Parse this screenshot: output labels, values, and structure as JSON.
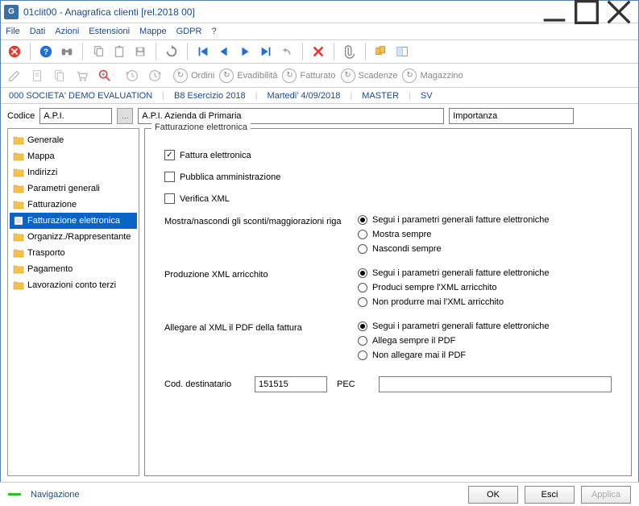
{
  "window": {
    "title": "01clit00 - Anagrafica clienti  [rel.2018 00]"
  },
  "menu": {
    "file": "File",
    "dati": "Dati",
    "azioni": "Azioni",
    "estensioni": "Estensioni",
    "mappe": "Mappe",
    "gdpr": "GDPR",
    "help": "?"
  },
  "toolbar2": {
    "ordini": "Ordini",
    "evadibilita": "Evadibilità",
    "fatturato": "Fatturato",
    "scadenze": "Scadenze",
    "magazzino": "Magazzino"
  },
  "status": {
    "company": "000 SOCIETA' DEMO EVALUATION",
    "exercise": "B8 Esercizio 2018",
    "date": "Martedi'  4/09/2018",
    "user": "MASTER",
    "sv": "SV"
  },
  "codice": {
    "label": "Codice",
    "value": "A.P.I.",
    "desc": "A.P.I. Azienda di Primaria",
    "importanza": "Importanza"
  },
  "sidebar": {
    "items": [
      {
        "label": "Generale"
      },
      {
        "label": "Mappa"
      },
      {
        "label": "Indirizzi"
      },
      {
        "label": "Parametri generali"
      },
      {
        "label": "Fatturazione"
      },
      {
        "label": "Fatturazione elettronica",
        "selected": true
      },
      {
        "label": "Organizz./Rappresentante"
      },
      {
        "label": "Trasporto"
      },
      {
        "label": "Pagamento"
      },
      {
        "label": "Lavorazioni conto terzi"
      }
    ]
  },
  "fieldset": {
    "legend": "Fatturazione elettronica",
    "chk_fattura": "Fattura elettronica",
    "chk_pubblica": "Pubblica amministrazione",
    "chk_verifica": "Verifica XML",
    "group1_label": "Mostra/nascondi gli sconti/maggiorazioni riga",
    "group1": [
      "Segui i parametri generali fatture elettroniche",
      "Mostra sempre",
      "Nascondi sempre"
    ],
    "group2_label": "Produzione XML arricchito",
    "group2": [
      "Segui i parametri generali fatture elettroniche",
      "Produci sempre l'XML arricchito",
      "Non produrre mai l'XML arricchito"
    ],
    "group3_label": "Allegare al XML il PDF della fattura",
    "group3": [
      "Segui i parametri generali fatture elettroniche",
      "Allega sempre il PDF",
      "Non allegare mai il PDF"
    ],
    "cod_dest_label": "Cod. destinatario",
    "cod_dest_value": "151515",
    "pec_label": "PEC",
    "pec_value": ""
  },
  "bottom": {
    "nav": "Navigazione",
    "ok": "OK",
    "esci": "Esci",
    "applica": "Applica"
  }
}
